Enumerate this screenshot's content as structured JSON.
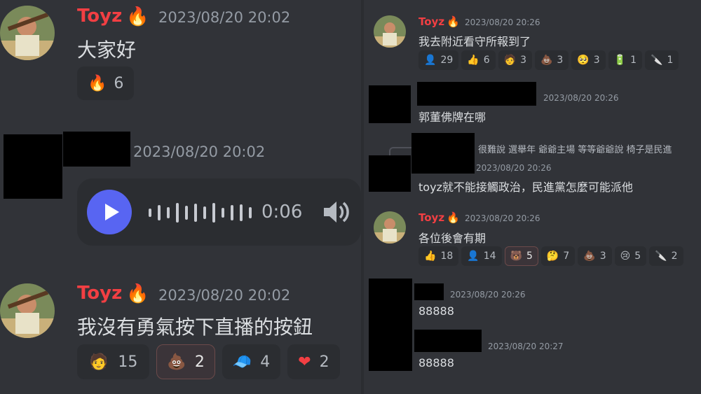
{
  "left": {
    "msg1": {
      "author": "Toyz",
      "timestamp": "2023/08/20 20:02",
      "text": "大家好",
      "reactions": [
        {
          "emoji": "fire-emoji",
          "count": "6"
        }
      ]
    },
    "msg2": {
      "timestamp": "2023/08/20 20:02",
      "voice": {
        "duration": "0:06"
      }
    },
    "msg3": {
      "author": "Toyz",
      "timestamp": "2023/08/20 20:02",
      "text": "我沒有勇氣按下直播的按鈕",
      "reactions": [
        {
          "emoji": "face-sticker-emoji",
          "count": "15"
        },
        {
          "emoji": "poop-emoji",
          "count": "2"
        },
        {
          "emoji": "cap-emoji",
          "count": "4"
        },
        {
          "emoji": "heart-emoji",
          "count": "2"
        }
      ]
    }
  },
  "right": {
    "msg1": {
      "author": "Toyz",
      "timestamp": "2023/08/20 20:26",
      "text": "我去附近看守所報到了",
      "reactions": [
        {
          "emoji": "sticker-emoji",
          "count": "29"
        },
        {
          "emoji": "thumbs-up-emoji",
          "count": "6"
        },
        {
          "emoji": "face-emoji",
          "count": "3"
        },
        {
          "emoji": "poop-emoji",
          "count": "3"
        },
        {
          "emoji": "pleading-emoji",
          "count": "3"
        },
        {
          "emoji": "battery-emoji",
          "count": "1"
        },
        {
          "emoji": "knife-emoji",
          "count": "1"
        }
      ]
    },
    "msg2": {
      "timestamp": "2023/08/20 20:26",
      "text": "郭董佛牌在哪"
    },
    "msg3": {
      "reply_preview": "很難說 選舉年 爺爺主場 等等爺爺說 椅子是民進",
      "timestamp": "2023/08/20 20:26",
      "text": "toyz就不能接觸政治，民進黨怎麼可能派他"
    },
    "msg4": {
      "author": "Toyz",
      "timestamp": "2023/08/20 20:26",
      "text": "各位後會有期",
      "reactions": [
        {
          "emoji": "thumbs-up-emoji",
          "count": "18"
        },
        {
          "emoji": "sticker-emoji",
          "count": "14"
        },
        {
          "emoji": "bear-emoji",
          "count": "5"
        },
        {
          "emoji": "thinking-emoji",
          "count": "7"
        },
        {
          "emoji": "poop-emoji",
          "count": "3"
        },
        {
          "emoji": "crying-emoji",
          "count": "5"
        },
        {
          "emoji": "knife-emoji",
          "count": "2"
        }
      ]
    },
    "msg5": {
      "timestamp": "2023/08/20 20:26",
      "text": "88888"
    },
    "msg6": {
      "timestamp": "2023/08/20 20:27",
      "text": "88888"
    }
  },
  "colors": {
    "background": "#313338",
    "author": "#f23f43",
    "timestamp": "#949ba4",
    "text": "#dbdee1",
    "reaction_bg": "#2b2d31",
    "play_button": "#5865f2",
    "heart": "#f23f43",
    "poop": "#c8603a"
  }
}
